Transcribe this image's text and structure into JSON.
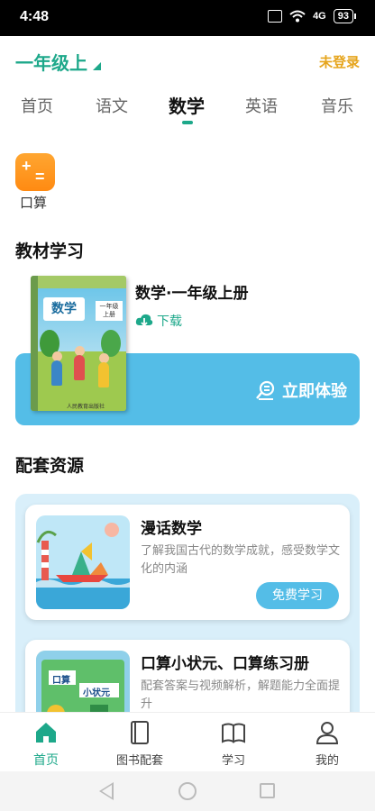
{
  "status_bar": {
    "time": "4:48",
    "signal": "4G",
    "battery": "93"
  },
  "header": {
    "grade": "一年级上",
    "login": "未登录"
  },
  "subject_tabs": [
    "首页",
    "语文",
    "数学",
    "英语",
    "音乐"
  ],
  "active_tab": "数学",
  "tools": {
    "kousuan_label": "口算"
  },
  "textbook": {
    "section_title": "教材学习",
    "name": "数学·一年级上册",
    "download": "下载",
    "try_button": "立即体验",
    "cover_title": "数学",
    "cover_grade": "一年级",
    "cover_term": "上册",
    "cover_publisher": "人民教育出版社"
  },
  "resources": {
    "section_title": "配套资源",
    "items": [
      {
        "title": "漫话数学",
        "desc": "了解我国古代的数学成就，感受数学文化的内涵",
        "button": "免费学习"
      },
      {
        "title": "口算小状元、口算练习册",
        "desc": "配套答案与视频解析，解题能力全面提升",
        "thumb_text_1": "口算",
        "thumb_text_2": "小状元"
      }
    ]
  },
  "bottom_nav": [
    "首页",
    "图书配套",
    "学习",
    "我的"
  ],
  "colors": {
    "accent": "#1da88a",
    "login": "#e6a51d",
    "blue": "#54bde7",
    "panel": "#d9effa"
  }
}
